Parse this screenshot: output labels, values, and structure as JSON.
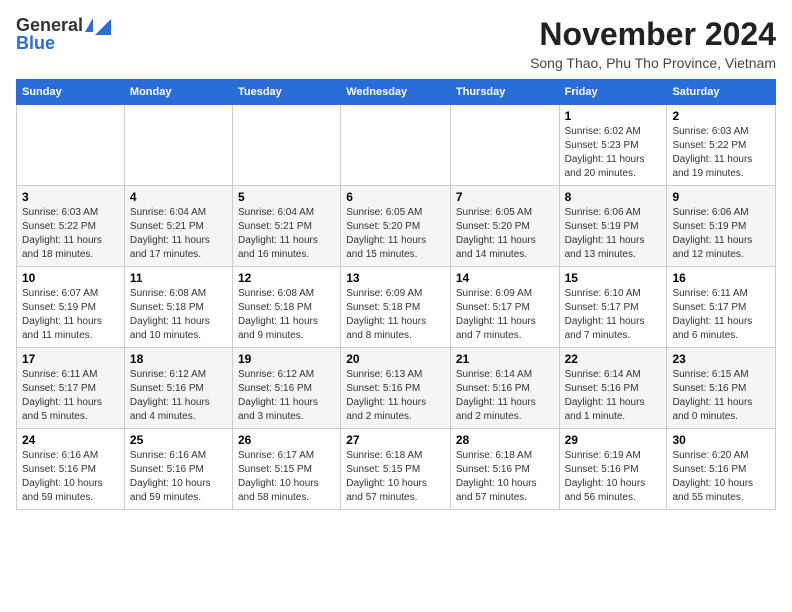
{
  "logo": {
    "general": "General",
    "blue": "Blue"
  },
  "title": "November 2024",
  "location": "Song Thao, Phu Tho Province, Vietnam",
  "headers": [
    "Sunday",
    "Monday",
    "Tuesday",
    "Wednesday",
    "Thursday",
    "Friday",
    "Saturday"
  ],
  "weeks": [
    [
      {
        "day": "",
        "info": ""
      },
      {
        "day": "",
        "info": ""
      },
      {
        "day": "",
        "info": ""
      },
      {
        "day": "",
        "info": ""
      },
      {
        "day": "",
        "info": ""
      },
      {
        "day": "1",
        "info": "Sunrise: 6:02 AM\nSunset: 5:23 PM\nDaylight: 11 hours and 20 minutes."
      },
      {
        "day": "2",
        "info": "Sunrise: 6:03 AM\nSunset: 5:22 PM\nDaylight: 11 hours and 19 minutes."
      }
    ],
    [
      {
        "day": "3",
        "info": "Sunrise: 6:03 AM\nSunset: 5:22 PM\nDaylight: 11 hours and 18 minutes."
      },
      {
        "day": "4",
        "info": "Sunrise: 6:04 AM\nSunset: 5:21 PM\nDaylight: 11 hours and 17 minutes."
      },
      {
        "day": "5",
        "info": "Sunrise: 6:04 AM\nSunset: 5:21 PM\nDaylight: 11 hours and 16 minutes."
      },
      {
        "day": "6",
        "info": "Sunrise: 6:05 AM\nSunset: 5:20 PM\nDaylight: 11 hours and 15 minutes."
      },
      {
        "day": "7",
        "info": "Sunrise: 6:05 AM\nSunset: 5:20 PM\nDaylight: 11 hours and 14 minutes."
      },
      {
        "day": "8",
        "info": "Sunrise: 6:06 AM\nSunset: 5:19 PM\nDaylight: 11 hours and 13 minutes."
      },
      {
        "day": "9",
        "info": "Sunrise: 6:06 AM\nSunset: 5:19 PM\nDaylight: 11 hours and 12 minutes."
      }
    ],
    [
      {
        "day": "10",
        "info": "Sunrise: 6:07 AM\nSunset: 5:19 PM\nDaylight: 11 hours and 11 minutes."
      },
      {
        "day": "11",
        "info": "Sunrise: 6:08 AM\nSunset: 5:18 PM\nDaylight: 11 hours and 10 minutes."
      },
      {
        "day": "12",
        "info": "Sunrise: 6:08 AM\nSunset: 5:18 PM\nDaylight: 11 hours and 9 minutes."
      },
      {
        "day": "13",
        "info": "Sunrise: 6:09 AM\nSunset: 5:18 PM\nDaylight: 11 hours and 8 minutes."
      },
      {
        "day": "14",
        "info": "Sunrise: 6:09 AM\nSunset: 5:17 PM\nDaylight: 11 hours and 7 minutes."
      },
      {
        "day": "15",
        "info": "Sunrise: 6:10 AM\nSunset: 5:17 PM\nDaylight: 11 hours and 7 minutes."
      },
      {
        "day": "16",
        "info": "Sunrise: 6:11 AM\nSunset: 5:17 PM\nDaylight: 11 hours and 6 minutes."
      }
    ],
    [
      {
        "day": "17",
        "info": "Sunrise: 6:11 AM\nSunset: 5:17 PM\nDaylight: 11 hours and 5 minutes."
      },
      {
        "day": "18",
        "info": "Sunrise: 6:12 AM\nSunset: 5:16 PM\nDaylight: 11 hours and 4 minutes."
      },
      {
        "day": "19",
        "info": "Sunrise: 6:12 AM\nSunset: 5:16 PM\nDaylight: 11 hours and 3 minutes."
      },
      {
        "day": "20",
        "info": "Sunrise: 6:13 AM\nSunset: 5:16 PM\nDaylight: 11 hours and 2 minutes."
      },
      {
        "day": "21",
        "info": "Sunrise: 6:14 AM\nSunset: 5:16 PM\nDaylight: 11 hours and 2 minutes."
      },
      {
        "day": "22",
        "info": "Sunrise: 6:14 AM\nSunset: 5:16 PM\nDaylight: 11 hours and 1 minute."
      },
      {
        "day": "23",
        "info": "Sunrise: 6:15 AM\nSunset: 5:16 PM\nDaylight: 11 hours and 0 minutes."
      }
    ],
    [
      {
        "day": "24",
        "info": "Sunrise: 6:16 AM\nSunset: 5:16 PM\nDaylight: 10 hours and 59 minutes."
      },
      {
        "day": "25",
        "info": "Sunrise: 6:16 AM\nSunset: 5:16 PM\nDaylight: 10 hours and 59 minutes."
      },
      {
        "day": "26",
        "info": "Sunrise: 6:17 AM\nSunset: 5:15 PM\nDaylight: 10 hours and 58 minutes."
      },
      {
        "day": "27",
        "info": "Sunrise: 6:18 AM\nSunset: 5:15 PM\nDaylight: 10 hours and 57 minutes."
      },
      {
        "day": "28",
        "info": "Sunrise: 6:18 AM\nSunset: 5:16 PM\nDaylight: 10 hours and 57 minutes."
      },
      {
        "day": "29",
        "info": "Sunrise: 6:19 AM\nSunset: 5:16 PM\nDaylight: 10 hours and 56 minutes."
      },
      {
        "day": "30",
        "info": "Sunrise: 6:20 AM\nSunset: 5:16 PM\nDaylight: 10 hours and 55 minutes."
      }
    ]
  ]
}
